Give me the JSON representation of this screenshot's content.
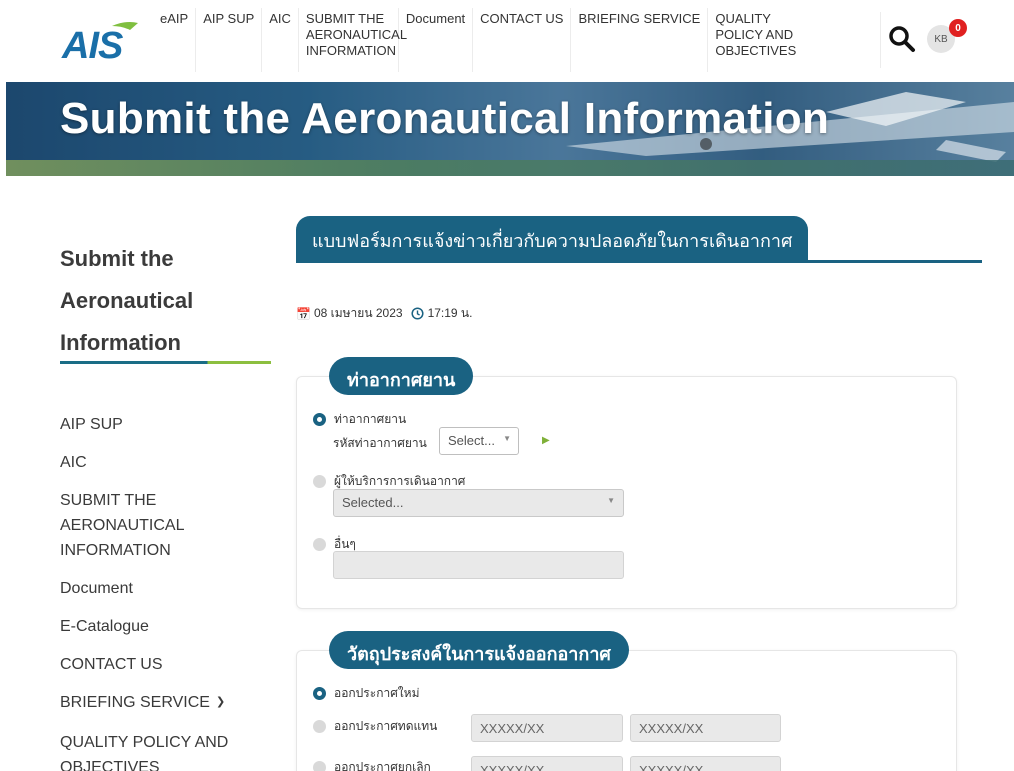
{
  "header": {
    "logo_text": "AIS",
    "nav": [
      {
        "label": "eAIP"
      },
      {
        "label": "AIP SUP"
      },
      {
        "label": "AIC"
      },
      {
        "label": "SUBMIT THE\nAERONAUTICAL\nINFORMATION"
      },
      {
        "label": "Document"
      },
      {
        "label": "CONTACT US"
      },
      {
        "label": "BRIEFING SERVICE"
      },
      {
        "label": "QUALITY\nPOLICY AND\nOBJECTIVES"
      }
    ],
    "avatar_initials": "KB",
    "notification_count": "0"
  },
  "banner": {
    "title": "Submit the Aeronautical Information"
  },
  "sidebar": {
    "title": "Submit the Aeronautical Information",
    "items": [
      {
        "label": "AIP SUP"
      },
      {
        "label": "AIC"
      },
      {
        "label": "SUBMIT THE AERONAUTICAL INFORMATION"
      },
      {
        "label": "Document"
      },
      {
        "label": "E-Catalogue"
      },
      {
        "label": "CONTACT US"
      },
      {
        "label": "BRIEFING SERVICE"
      },
      {
        "label": "QUALITY POLICY AND OBJECTIVES"
      }
    ]
  },
  "form": {
    "title": "แบบฟอร์มการแจ้งข่าวเกี่ยวกับความปลอดภัยในการเดินอากาศ",
    "date": "08 เมษายน 2023",
    "time": "17:19 น.",
    "section1": {
      "title": "ท่าอากาศยาน",
      "opt_airport": "ท่าอากาศยาน",
      "airport_code_label": "รหัสท่าอากาศยาน",
      "airport_select": "Select...",
      "opt_provider": "ผู้ให้บริการการเดินอากาศ",
      "provider_select": "Selected...",
      "opt_other": "อื่นๆ"
    },
    "section2": {
      "title": "วัตถุประสงค์ในการแจ้งออกอากาศ",
      "opt_new": "ออกประกาศใหม่",
      "opt_replace": "ออกประกาศทดแทน",
      "opt_cancel": "ออกประกาศยกเลิก",
      "ph_a": "XXXXX/XX",
      "ph_b": "XXXXX/XX"
    }
  }
}
